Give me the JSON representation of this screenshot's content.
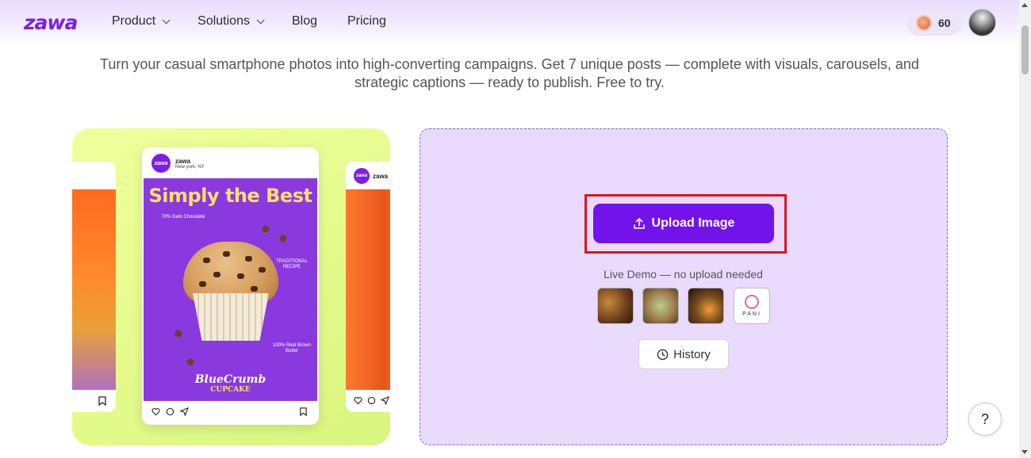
{
  "header": {
    "logo": "zawa",
    "nav": [
      {
        "label": "Product",
        "dropdown": true
      },
      {
        "label": "Solutions",
        "dropdown": true
      },
      {
        "label": "Blog",
        "dropdown": false
      },
      {
        "label": "Pricing",
        "dropdown": false
      }
    ],
    "credits": "60"
  },
  "hero": {
    "subtitle": "Turn your casual smartphone photos into high-converting campaigns. Get 7 unique posts — complete with visuals, carousels, and strategic captions — ready to publish. Free to try."
  },
  "preview": {
    "account_name": "zawa",
    "account_location": "New york, NY",
    "post_title": "Simply the Best",
    "note_1": "70% Dark Chocolate",
    "note_2": "TRADITIONAL RECIPE",
    "note_3": "100% Real Brown Butter",
    "brand_name": "BlueCrumb",
    "brand_sub": "CUPCAKE"
  },
  "upload": {
    "button_label": "Upload Image",
    "demo_label": "Live Demo — no upload needed",
    "demo_brand_text": "PANI",
    "history_label": "History"
  },
  "help": {
    "label": "?"
  },
  "colors": {
    "brand": "#7c1fe6",
    "upload_button": "#7213ec",
    "panel_bg": "#e8dbfd",
    "highlight": "#e0141e",
    "preview_bg": "#e4fb8c"
  }
}
